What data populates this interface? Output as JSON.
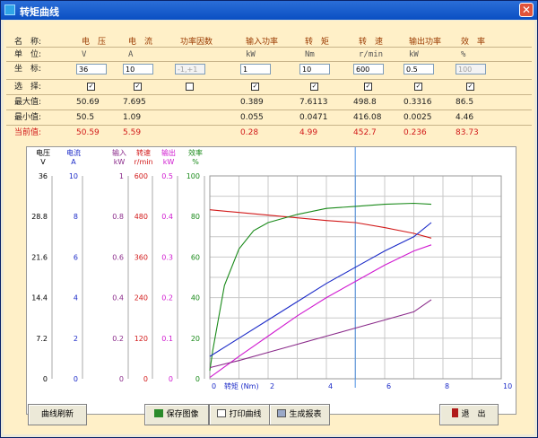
{
  "window": {
    "title": "转矩曲线",
    "close_glyph": "✕"
  },
  "table": {
    "row_labels": {
      "name": "名　称:",
      "unit": "单　位:",
      "coord": "坐　标:",
      "select": "选　择:",
      "max": "最大值:",
      "min": "最小值:",
      "current": "当前值:"
    },
    "columns": [
      {
        "name": "电　压",
        "unit": "V",
        "coord": "36",
        "coord_disabled": false,
        "selected": true,
        "max": "50.69",
        "min": "50.5",
        "current": "50.59"
      },
      {
        "name": "电　流",
        "unit": "A",
        "coord": "10",
        "coord_disabled": false,
        "selected": true,
        "max": "7.695",
        "min": "1.09",
        "current": "5.59"
      },
      {
        "name": "功率因数",
        "unit": "",
        "coord": "-1,+1",
        "coord_disabled": true,
        "selected": false,
        "max": "",
        "min": "",
        "current": ""
      },
      {
        "name": "输入功率",
        "unit": "kW",
        "coord": "1",
        "coord_disabled": false,
        "selected": true,
        "max": "0.389",
        "min": "0.055",
        "current": "0.28"
      },
      {
        "name": "转　矩",
        "unit": "Nm",
        "coord": "10",
        "coord_disabled": false,
        "selected": true,
        "max": "7.6113",
        "min": "0.0471",
        "current": "4.99"
      },
      {
        "name": "转　速",
        "unit": "r/min",
        "coord": "600",
        "coord_disabled": false,
        "selected": true,
        "max": "498.8",
        "min": "416.08",
        "current": "452.7"
      },
      {
        "name": "输出功率",
        "unit": "kW",
        "coord": "0.5",
        "coord_disabled": false,
        "selected": true,
        "max": "0.3316",
        "min": "0.0025",
        "current": "0.236"
      },
      {
        "name": "效　率",
        "unit": "%",
        "coord": "100",
        "coord_disabled": true,
        "selected": true,
        "max": "86.5",
        "min": "4.46",
        "current": "83.73"
      }
    ]
  },
  "chart_data": {
    "type": "line",
    "xlabel": "0 转矩 (Nm)",
    "xlim": [
      0,
      10
    ],
    "x_ticks": [
      "0",
      "2",
      "4",
      "6",
      "8",
      "10"
    ],
    "cursor_x": 4.99,
    "axes": [
      {
        "name": "电压",
        "unit": "V",
        "ticks": [
          "36",
          "28.8",
          "21.6",
          "14.4",
          "7.2",
          "0"
        ],
        "color": "#000000"
      },
      {
        "name": "电流",
        "unit": "A",
        "ticks": [
          "10",
          "8",
          "6",
          "4",
          "2",
          "0"
        ],
        "color": "#1c2bc8"
      },
      {
        "name": "输入",
        "unit": "kW",
        "ticks": [
          "1",
          "0.8",
          "0.6",
          "0.4",
          "0.2",
          "0"
        ],
        "color": "#8a2a8a"
      },
      {
        "name": "转速",
        "unit": "r/min",
        "ticks": [
          "600",
          "480",
          "360",
          "240",
          "120",
          "0"
        ],
        "color": "#d21a1a"
      },
      {
        "name": "输出",
        "unit": "kW",
        "ticks": [
          "0.5",
          "0.4",
          "0.3",
          "0.2",
          "0.1",
          "0"
        ],
        "color": "#d01ad0"
      },
      {
        "name": "效率",
        "unit": "%",
        "ticks": [
          "100",
          "80",
          "60",
          "40",
          "20",
          "0"
        ],
        "color": "#1a8a1a"
      }
    ],
    "series": [
      {
        "color": "#d21a1a",
        "x": [
          0,
          1,
          2,
          3,
          4,
          5,
          6,
          7,
          7.6
        ],
        "y": [
          500,
          492,
          484,
          476,
          468,
          462,
          447,
          430,
          416
        ]
      },
      {
        "color": "#1a8a1a",
        "x": [
          0,
          0.1,
          0.3,
          0.5,
          1,
          1.5,
          2,
          3,
          4,
          5,
          6,
          7,
          7.6
        ],
        "y": [
          4,
          14,
          30,
          46,
          64,
          73,
          77,
          81,
          84,
          85,
          86,
          86.5,
          86
        ]
      },
      {
        "color": "#1c2bc8",
        "x": [
          0,
          1,
          2,
          3,
          4,
          5,
          6,
          7,
          7.6
        ],
        "y": [
          1.1,
          2,
          2.9,
          3.8,
          4.7,
          5.5,
          6.3,
          7.0,
          7.7
        ]
      },
      {
        "color": "#d01ad0",
        "x": [
          0,
          1,
          2,
          3,
          4,
          5,
          6,
          7,
          7.6
        ],
        "y": [
          0.003,
          0.055,
          0.105,
          0.155,
          0.2,
          0.24,
          0.28,
          0.315,
          0.33
        ]
      },
      {
        "color": "#8a2a8a",
        "x": [
          0,
          1,
          2,
          3,
          4,
          5,
          6,
          7,
          7.6
        ],
        "y": [
          0.055,
          0.09,
          0.13,
          0.17,
          0.21,
          0.25,
          0.29,
          0.33,
          0.39
        ]
      }
    ]
  },
  "buttons": {
    "refresh": "曲线刷新",
    "save_image": "保存图像",
    "print_curve": "打印曲线",
    "report": "生成报表",
    "exit": "退　出"
  }
}
